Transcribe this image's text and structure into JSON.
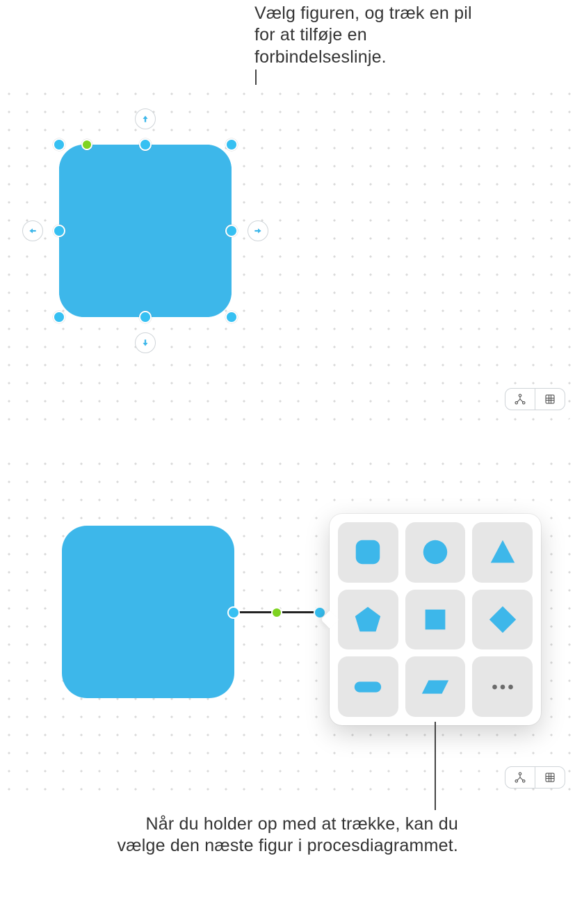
{
  "captions": {
    "top": "Vælg figuren, og træk en pil for at tilføje en forbindelseslinje.",
    "bottom": "Når du holder op med at trække, kan du vælge den næste figur i procesdiagrammet."
  },
  "shape": {
    "fill": "#3db7ea",
    "name": "rounded-rectangle"
  },
  "picker": {
    "shapes": [
      "rounded-square",
      "circle",
      "triangle",
      "pentagon",
      "square",
      "diamond",
      "pill",
      "parallelogram",
      "more"
    ]
  },
  "panel_controls": {
    "left": "connections-mode",
    "right": "grid-mode"
  },
  "arrow_handles": [
    "up",
    "right",
    "down",
    "left"
  ]
}
